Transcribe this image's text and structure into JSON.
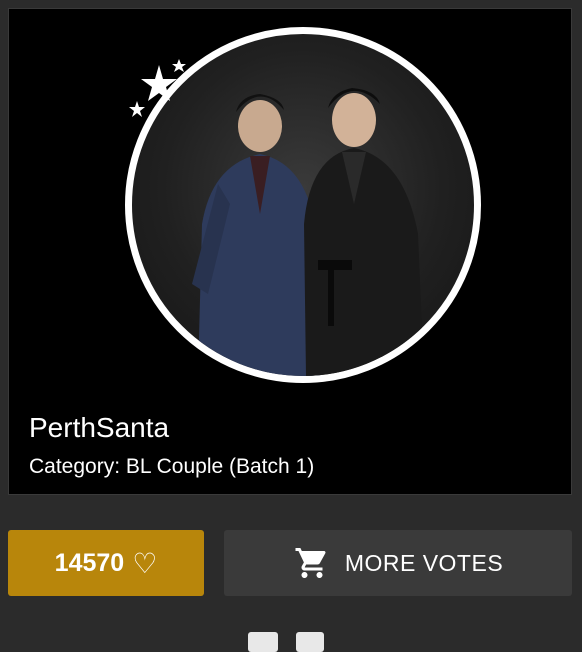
{
  "card": {
    "name": "PerthSanta",
    "category": "Category: BL Couple (Batch 1)"
  },
  "actions": {
    "vote_count": "14570",
    "heart_glyph": "♡",
    "more_votes_label": "MORE VOTES",
    "cart_icon": "shopping-cart-icon"
  },
  "colors": {
    "vote_button": "#b8860b",
    "more_button": "#3a3a3a",
    "card_bg": "#000000",
    "page_bg": "#2b2b2b"
  }
}
